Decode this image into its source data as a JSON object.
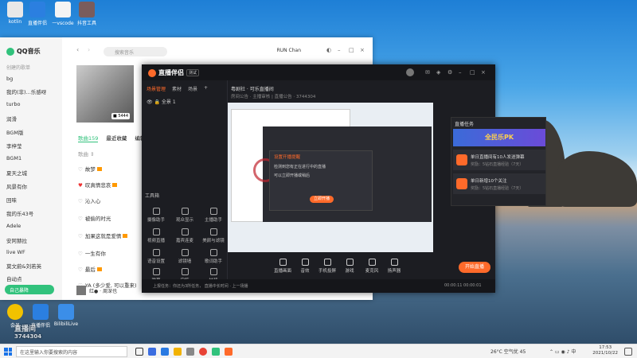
{
  "desktop": {
    "icons_top": [
      {
        "label": "kotlin"
      },
      {
        "label": "直播伴侣"
      },
      {
        "label": "一vscode"
      },
      {
        "label": "抖音工具"
      }
    ],
    "icons_bottom": [
      {
        "label": "会员"
      },
      {
        "label": "直播伴侣"
      },
      {
        "label": "BilibiliLive"
      }
    ],
    "watermark": {
      "line1": "直播间",
      "line2": "3744304"
    }
  },
  "qq": {
    "app_name": "QQ音乐",
    "sidebar_section": "创建的歌单",
    "sidebar_items": [
      "bg",
      "我的(非)...乐感呀",
      "turbo",
      "润滑",
      "BGM版",
      "李梓莹",
      "BGM1",
      "夏天之城",
      "风景有你",
      "回味",
      "我的乐43号",
      "Adele",
      "安阿赫拉",
      "live WF",
      "莫文蔚&刘若英",
      "自动点"
    ],
    "cta": "自己暴降",
    "search_placeholder": "搜索音乐",
    "user_name": "RUN Chan",
    "tag": "■ 5444",
    "tabs": [
      "歌曲159",
      "最近收藏",
      "编辑"
    ],
    "list_header": "歌曲 ⇕",
    "songs": [
      "故梦",
      "叹真情悲哀",
      "沁入心",
      "被偷的时光",
      "加果这就是爱情",
      "一生有你",
      "最后",
      "YA (多少爱, 可以重来)"
    ],
    "now_playing": "红●  · 周深也"
  },
  "zb": {
    "app_name": "直播伴侣",
    "version": "测试",
    "left_tabs": [
      "场景管理",
      "素材",
      "场景"
    ],
    "scene": "全景 1",
    "tools_title": "工具箱",
    "tools": [
      "摄像助手",
      "观众显示",
      "主播助手",
      "视频直播",
      "嘉宾连麦",
      "美颜与滤镜",
      "语音设置",
      "滤镜墙",
      "歌词助手",
      "弹幕",
      "宝箱",
      "抽奖"
    ],
    "room_title": "粤剧社 · 可乐直播间",
    "room_sub": "房间公告 · 主播审核 | 直播公告 · 3744304",
    "dialog": {
      "title": "设置开播提醒",
      "text1": "检测到您有正在进行中的直播",
      "text2": "可以立即开播或稍后",
      "button": "立即开播"
    },
    "task_panel": {
      "title": "直播任务",
      "banner": "全民乐PK",
      "tasks": [
        {
          "name": "单日直播间有10人发送弹幕",
          "sub": "奖励：5钻石直播经验（7天）"
        },
        {
          "name": "单日新增10个关注",
          "sub": "奖励：5钻石直播经验（7天）"
        }
      ]
    },
    "bottom_tools": [
      "直播画面",
      "音效",
      "手机投屏",
      "游戏",
      "麦克风",
      "扬声器"
    ],
    "start_live": "开始直播",
    "status_left": "上报任务：你还为3所任务， 直播中长时间  · 上一场播",
    "status_right": "00:00:11   00:00:01"
  },
  "taskbar": {
    "search_placeholder": "在这里输入你要搜索的内容",
    "weather": "26°C 空气优 45",
    "time": "17:53",
    "date": "2021/10/22"
  },
  "colors": {
    "qq_green": "#31c27c",
    "zb_orange": "#ff6a2a",
    "taskbar": "#f3f3f3"
  }
}
